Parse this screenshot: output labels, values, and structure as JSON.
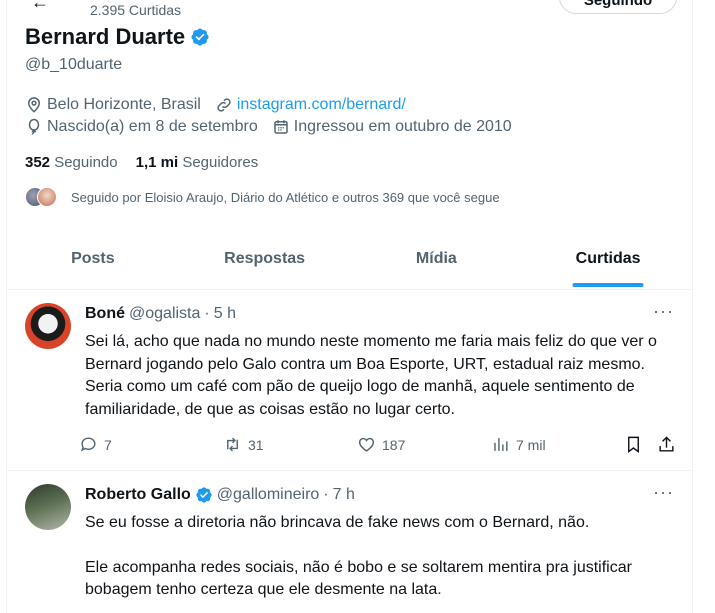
{
  "header": {
    "back_arrow": "←",
    "post_count": "2.395 Curtidas",
    "follow_button_label": "Seguindo"
  },
  "profile": {
    "name": "Bernard Duarte",
    "verified_icon": "verified-badge-icon",
    "handle": "@b_10duarte",
    "location": "Belo Horizonte, Brasil",
    "website": "instagram.com/bernard/",
    "birthday": "Nascido(a) em 8 de setembro",
    "joined": "Ingressou em outubro de 2010",
    "following_count": "352",
    "following_label": "Seguindo",
    "followers_count": "1,1 mi",
    "followers_label": "Seguidores",
    "followed_by": "Seguido por Eloisio Araujo, Diário do Atlético e outros 369 que você segue"
  },
  "tabs": [
    {
      "label": "Posts",
      "active": false
    },
    {
      "label": "Respostas",
      "active": false
    },
    {
      "label": "Mídia",
      "active": false
    },
    {
      "label": "Curtidas",
      "active": true
    }
  ],
  "tweets": [
    {
      "name": "Boné",
      "handle": "@ogalista",
      "separator": "·",
      "time": "5 h",
      "more": "···",
      "paragraphs": [
        "Sei lá, acho que nada no mundo neste momento me faria mais feliz do que ver o Bernard jogando pelo Galo contra um Boa Esporte, URT, estadual raiz mesmo. Seria como um café com pão de queijo logo de manhã, aquele sentimento de familiaridade, de que as coisas estão no lugar certo."
      ],
      "replies": "7",
      "retweets": "31",
      "likes": "187",
      "views": "7 mil"
    },
    {
      "name": "Roberto Gallo",
      "handle": "@gallomineiro",
      "separator": "·",
      "time": "7 h",
      "more": "···",
      "paragraphs": [
        "Se eu fosse a diretoria não brincava de fake news com o Bernard, não.",
        "Ele acompanha redes sociais, não é bobo e se soltarem mentira pra justificar bobagem tenho certeza que ele desmente na lata."
      ]
    }
  ],
  "colors": {
    "accent": "#1d9bf0",
    "text_primary": "#0f1419",
    "text_secondary": "#536471",
    "divider": "#eff3f4"
  }
}
